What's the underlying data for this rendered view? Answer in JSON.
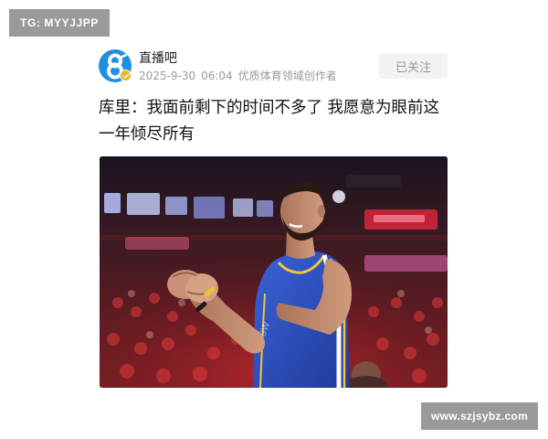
{
  "watermarks": {
    "top_left": "TG: MYYJJPP",
    "bottom_right": "www.szjsybz.com"
  },
  "post": {
    "author": {
      "name": "直播吧",
      "avatar_icon": "zhibo8-logo-icon",
      "verified_icon": "verified-badge-icon"
    },
    "date": "2025-9-30",
    "time": "06:04",
    "author_tag": "优质体育领域创作者",
    "follow_label": "已关注",
    "title": "库里：我面前剩下的时间不多了 我愿意为眼前这一年倾尽所有"
  },
  "colors": {
    "avatar_blue": "#1e8fe1",
    "badge_gold": "#f2b21a",
    "watermark_gray": "#9a9a9a",
    "jersey_blue": "#2f53c4"
  }
}
